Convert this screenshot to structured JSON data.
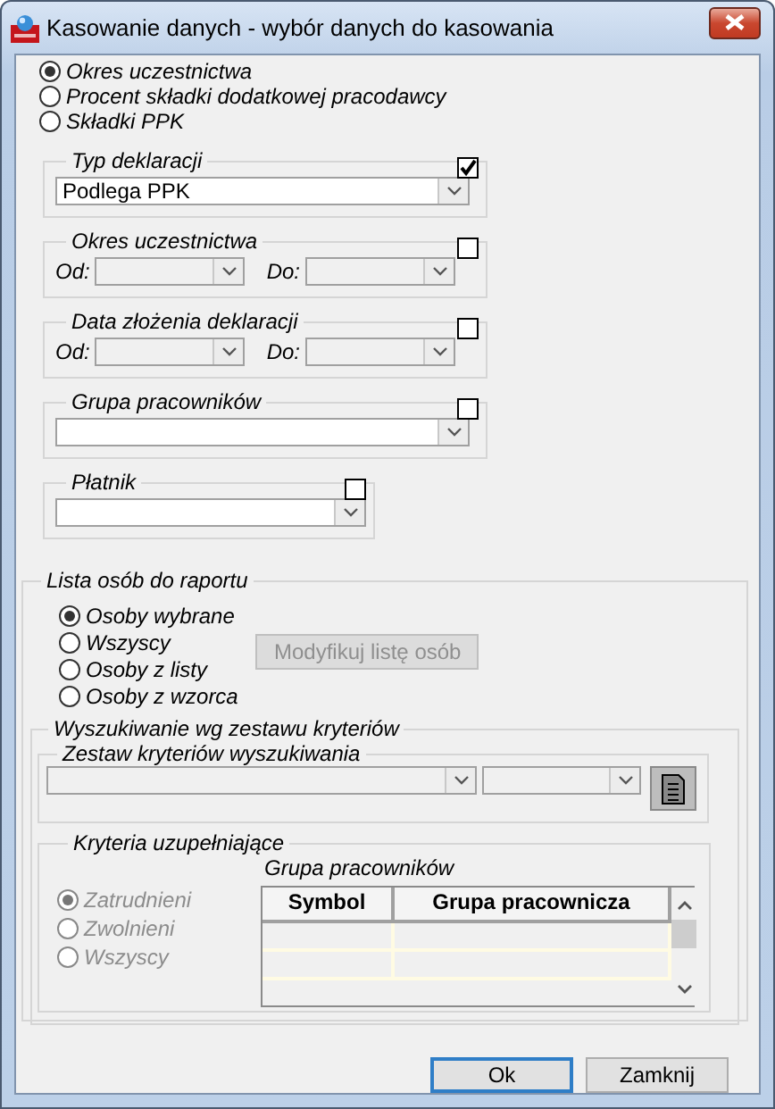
{
  "window": {
    "title": "Kasowanie danych - wybór danych do kasowania"
  },
  "data_types": [
    {
      "label": "Okres uczestnictwa",
      "selected": true
    },
    {
      "label": "Procent składki dodatkowej pracodawcy",
      "selected": false
    },
    {
      "label": "Składki PPK",
      "selected": false
    }
  ],
  "filters": [
    {
      "kind": "combo",
      "legend": "Typ deklaracji",
      "checked": true,
      "value": "Podlega PPK"
    },
    {
      "kind": "range",
      "legend": "Okres uczestnictwa",
      "checked": false,
      "from_label": "Od:",
      "to_label": "Do:"
    },
    {
      "kind": "range",
      "legend": "Data złożenia deklaracji",
      "checked": false,
      "from_label": "Od:",
      "to_label": "Do:"
    },
    {
      "kind": "combo",
      "legend": "Grupa pracowników",
      "checked": false
    },
    {
      "kind": "short_combo",
      "legend": "Płatnik",
      "checked": false
    }
  ],
  "person_list": {
    "legend": "Lista osób do raportu",
    "options": [
      {
        "label": "Osoby wybrane",
        "selected": true
      },
      {
        "label": "Wszyscy",
        "selected": false
      },
      {
        "label": "Osoby z listy",
        "selected": false
      },
      {
        "label": "Osoby z wzorca",
        "selected": false
      }
    ],
    "modify_button": {
      "label": "Modyfikuj listę osób",
      "disabled": true
    },
    "search": {
      "legend": "Wyszukiwanie wg zestawu kryteriów",
      "criteria_set": {
        "legend": "Zestaw kryteriów wyszukiwania"
      },
      "supplementary": {
        "legend": "Kryteria uzupełniające",
        "disabled": true,
        "options": [
          {
            "label": "Zatrudnieni",
            "selected": true
          },
          {
            "label": "Zwolnieni",
            "selected": false
          },
          {
            "label": "Wszyscy",
            "selected": false
          }
        ],
        "group_label": "Grupa pracowników",
        "table": {
          "columns": [
            "Symbol",
            "Grupa pracownicza"
          ]
        }
      }
    }
  },
  "buttons": [
    {
      "label": "Ok",
      "default": true
    },
    {
      "label": "Zamknij",
      "default": false
    }
  ]
}
